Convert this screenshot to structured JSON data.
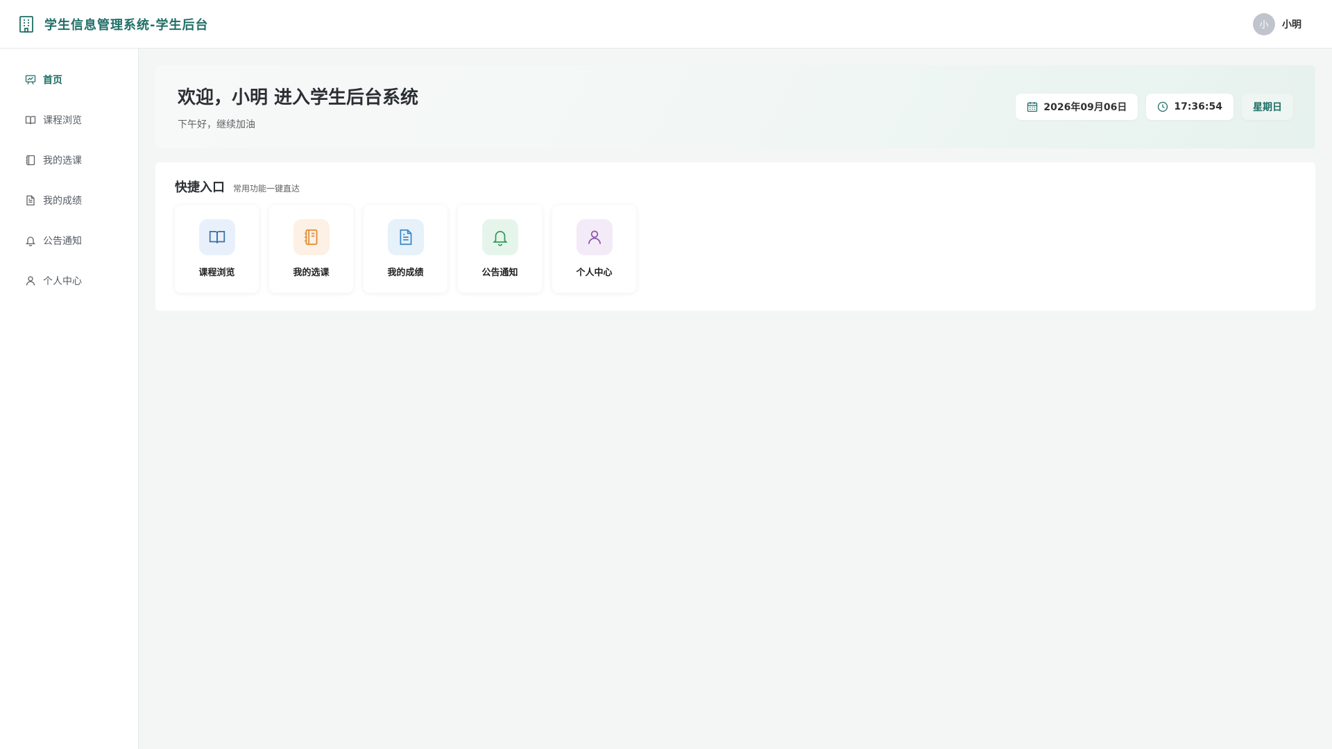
{
  "header": {
    "title": "学生信息管理系统-学生后台",
    "brand_icon": "building-icon",
    "user": {
      "avatar_text": "小",
      "name": "小明"
    }
  },
  "sidebar": {
    "items": [
      {
        "label": "首页",
        "icon": "presentation-chart-icon",
        "active": true
      },
      {
        "label": "课程浏览",
        "icon": "book-open-icon",
        "active": false
      },
      {
        "label": "我的选课",
        "icon": "notebook-icon",
        "active": false
      },
      {
        "label": "我的成绩",
        "icon": "document-icon",
        "active": false
      },
      {
        "label": "公告通知",
        "icon": "bell-icon",
        "active": false
      },
      {
        "label": "个人中心",
        "icon": "user-icon",
        "active": false
      }
    ]
  },
  "welcome": {
    "title": "欢迎，小明 进入学生后台系统",
    "subtitle": "下午好，继续加油",
    "date": "2026年09月06日",
    "time": "17:36:54",
    "weekday": "星期日"
  },
  "quick_access": {
    "title": "快捷入口",
    "subtitle": "常用功能一键直达",
    "cards": [
      {
        "label": "课程浏览",
        "icon": "book-open-icon",
        "bg": "#e8f1fb",
        "color": "#3a6ea5"
      },
      {
        "label": "我的选课",
        "icon": "notebook-icon",
        "bg": "#fdf0e4",
        "color": "#e08a2e"
      },
      {
        "label": "我的成绩",
        "icon": "document-icon",
        "bg": "#e6f1fa",
        "color": "#3a86c4"
      },
      {
        "label": "公告通知",
        "icon": "bell-icon",
        "bg": "#e6f5ec",
        "color": "#2f9a55"
      },
      {
        "label": "个人中心",
        "icon": "user-icon",
        "bg": "#f3ebf7",
        "color": "#8a56a8"
      }
    ]
  },
  "colors": {
    "brand": "#1f6f66",
    "background": "#f4f6f5"
  }
}
